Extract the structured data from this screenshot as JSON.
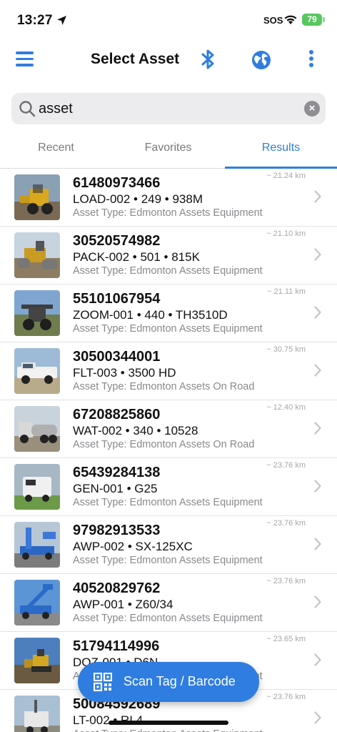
{
  "status": {
    "time": "13:27",
    "sos": "SOS",
    "battery": "79"
  },
  "nav": {
    "title": "Select Asset",
    "icons": [
      "menu-icon",
      "bluetooth-icon",
      "globe-icon",
      "more-vertical-icon"
    ]
  },
  "search": {
    "value": "asset",
    "placeholder": ""
  },
  "tabs": [
    {
      "label": "Recent",
      "active": false
    },
    {
      "label": "Favorites",
      "active": false
    },
    {
      "label": "Results",
      "active": true
    }
  ],
  "results": [
    {
      "number": "61480973466",
      "desc": "LOAD-002 • 249 • 938M",
      "type": "Asset Type: Edmonton Assets Equipment",
      "distance": "~ 21.24 km"
    },
    {
      "number": "30520574982",
      "desc": "PACK-002 • 501 • 815K",
      "type": "Asset Type: Edmonton Assets Equipment",
      "distance": "~ 21.10 km"
    },
    {
      "number": "55101067954",
      "desc": "ZOOM-001 • 440 • TH3510D",
      "type": "Asset Type: Edmonton Assets Equipment",
      "distance": "~ 21.11 km"
    },
    {
      "number": "30500344001",
      "desc": "FLT-003 • 3500 HD",
      "type": "Asset Type: Edmonton Assets On Road",
      "distance": "~ 30.75 km"
    },
    {
      "number": "67208825860",
      "desc": "WAT-002 • 340 • 10528",
      "type": "Asset Type: Edmonton Assets On Road",
      "distance": "~ 12.40 km"
    },
    {
      "number": "65439284138",
      "desc": "GEN-001 • G25",
      "type": "Asset Type: Edmonton Assets Equipment",
      "distance": "~ 23.76 km"
    },
    {
      "number": "97982913533",
      "desc": "AWP-002 • SX-125XC",
      "type": "Asset Type: Edmonton Assets Equipment",
      "distance": "~ 23.76 km"
    },
    {
      "number": "40520829762",
      "desc": "AWP-001 • Z60/34",
      "type": "Asset Type: Edmonton Assets Equipment",
      "distance": "~ 23.76 km"
    },
    {
      "number": "51794114996",
      "desc": "DOZ-001 • D6N",
      "type": "Asset Type: Edmonton Assets Equipment",
      "distance": "~ 23.65 km"
    },
    {
      "number": "50084592689",
      "desc": "LT-002 • RL4",
      "type": "Asset Type: Edmonton Assets Equipment",
      "distance": "~ 23.76 km"
    }
  ],
  "scan_button": {
    "label": "Scan Tag / Barcode"
  },
  "colors": {
    "accent": "#2f7de1",
    "battery": "#58c760"
  }
}
